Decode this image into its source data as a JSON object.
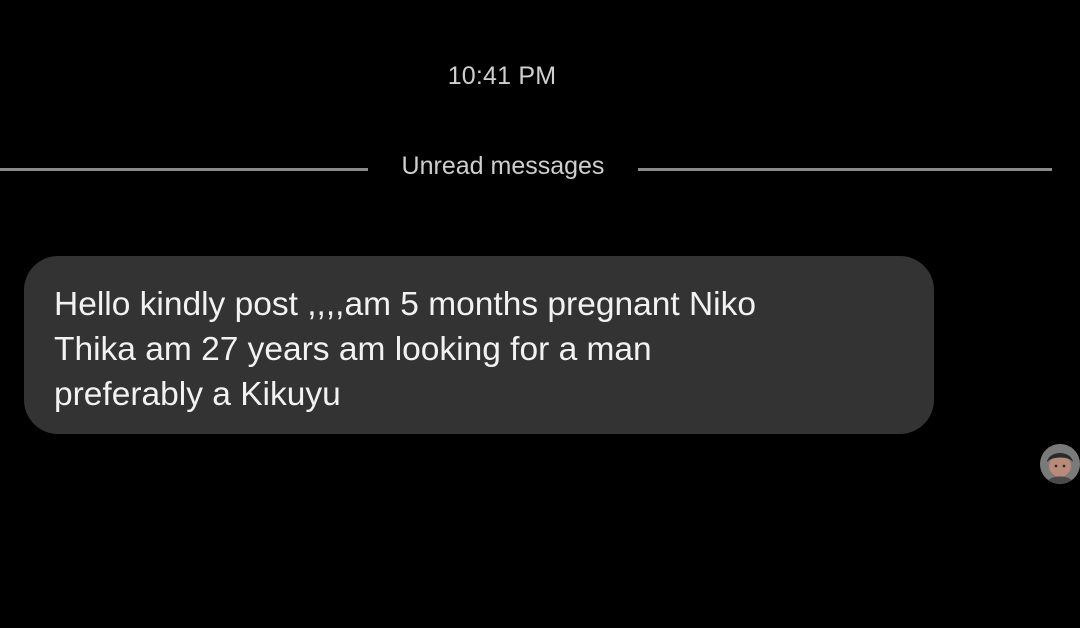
{
  "chat": {
    "timestamp": "10:41 PM",
    "divider_label": "Unread messages",
    "message": {
      "lines": [
        "Hello kindly post ,,,,am 5 months pregnant Niko",
        "Thika am 27 years am looking for a man",
        "preferably a Kikuyu"
      ]
    },
    "avatar_icon": "user-avatar-icon"
  },
  "colors": {
    "background": "#000000",
    "bubble": "#333333",
    "text": "#f2f2f2",
    "muted_text": "#cfcfcf",
    "divider": "#8a8a8a"
  }
}
